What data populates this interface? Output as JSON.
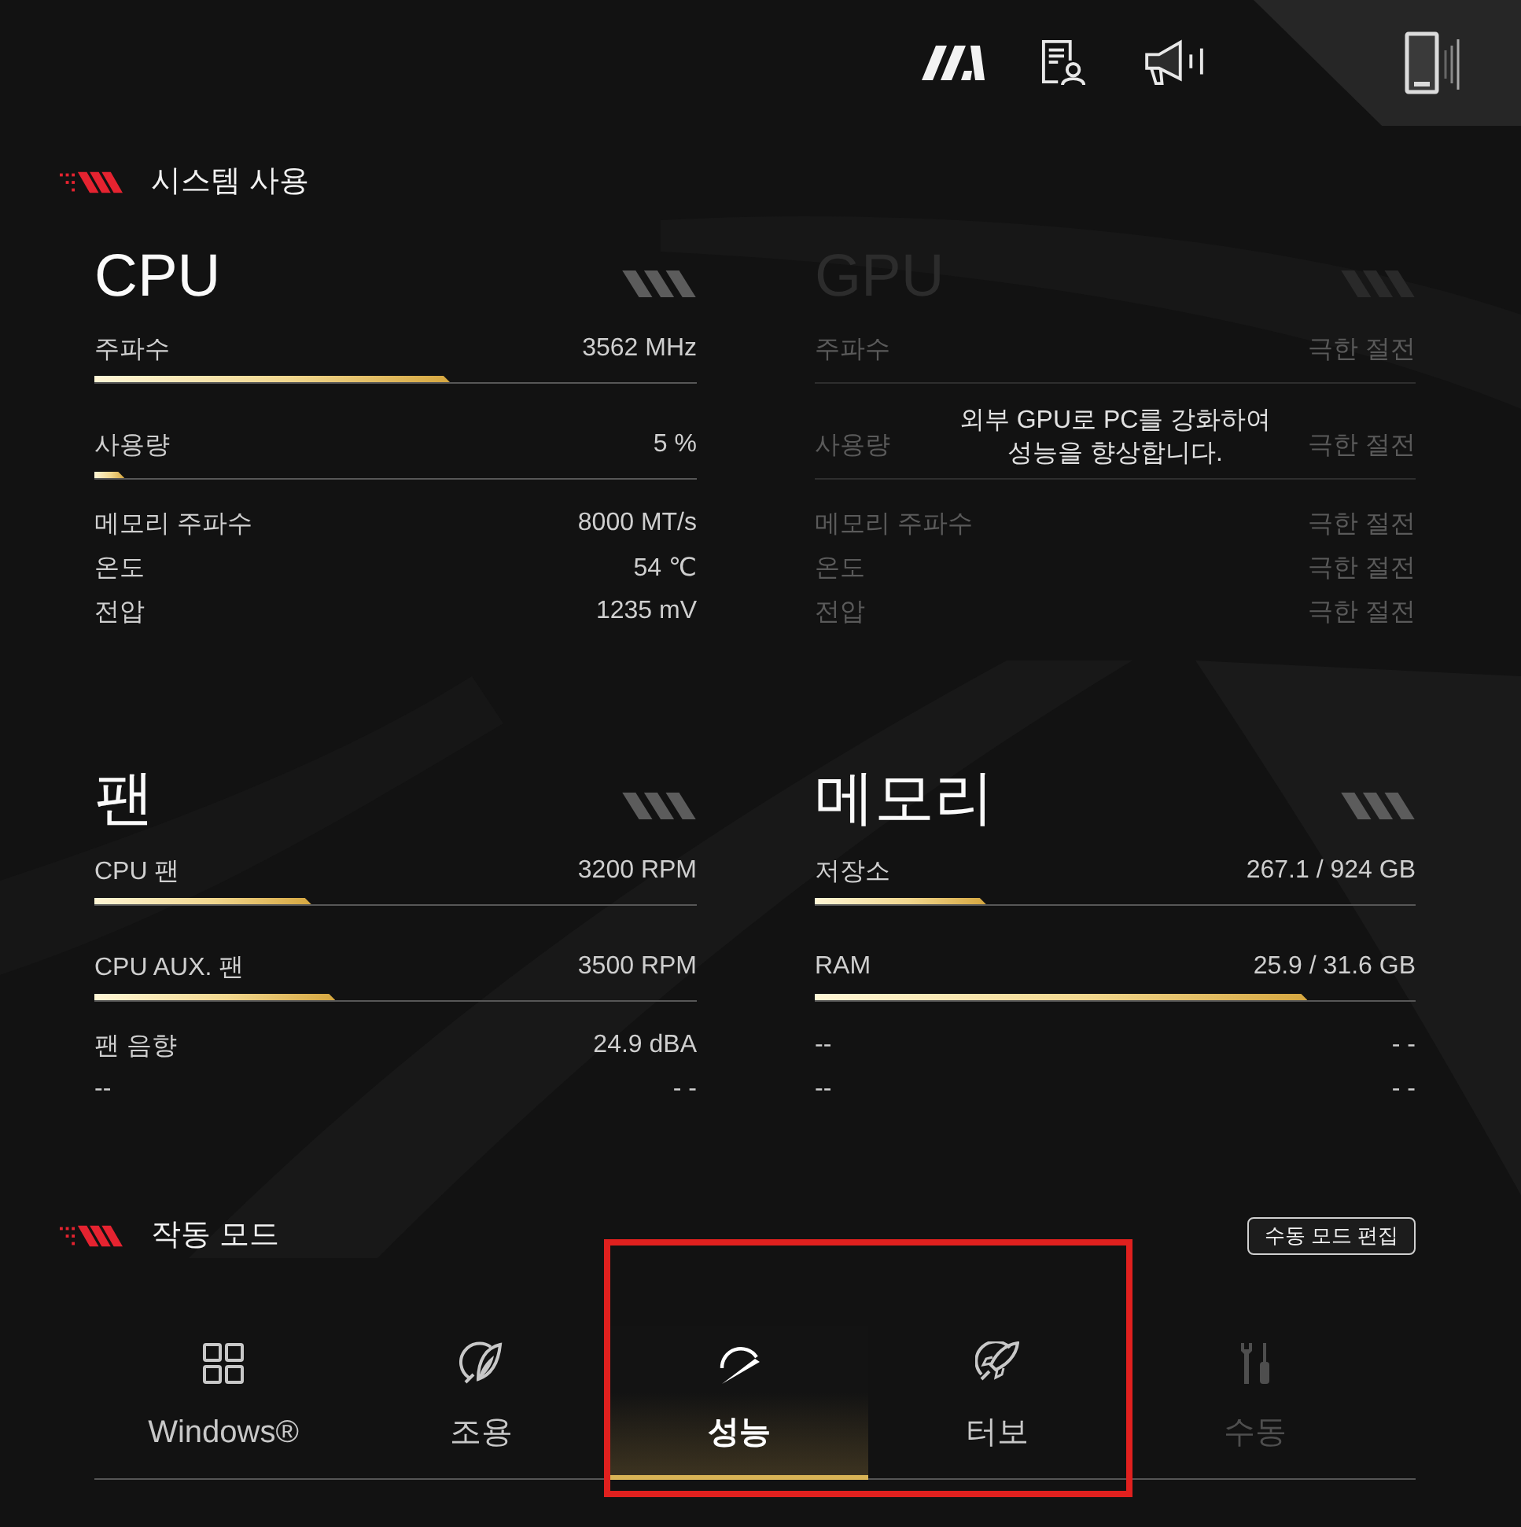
{
  "system_usage": {
    "title": "시스템 사용",
    "cards": [
      {
        "title": "CPU",
        "disabled": false,
        "rows": [
          {
            "kind": "bar",
            "label": "주파수",
            "value": "3562 MHz",
            "level": 0.59
          },
          {
            "kind": "bar",
            "label": "사용량",
            "value": "5 %",
            "level": 0.05
          },
          {
            "kind": "plain",
            "label": "메모리 주파수",
            "value": "8000 MT/s"
          },
          {
            "kind": "plain",
            "label": "온도",
            "value": "54 ℃"
          },
          {
            "kind": "plain",
            "label": "전압",
            "value": "1235 mV"
          }
        ]
      },
      {
        "title": "GPU",
        "disabled": true,
        "overlay_message": "외부 GPU로 PC를 강화하여 성능을 향상합니다.",
        "rows": [
          {
            "kind": "bar",
            "label": "주파수",
            "value": "극한 절전"
          },
          {
            "kind": "bar",
            "label": "사용량",
            "value": "극한 절전"
          },
          {
            "kind": "plain",
            "label": "메모리 주파수",
            "value": "극한 절전"
          },
          {
            "kind": "plain",
            "label": "온도",
            "value": "극한 절전"
          },
          {
            "kind": "plain",
            "label": "전압",
            "value": "극한 절전"
          }
        ]
      },
      {
        "title": "팬",
        "disabled": false,
        "rows": [
          {
            "kind": "bar",
            "label": "CPU 팬",
            "value": "3200 RPM",
            "level": 0.36
          },
          {
            "kind": "bar",
            "label": "CPU AUX. 팬",
            "value": "3500 RPM",
            "level": 0.4
          },
          {
            "kind": "plain",
            "label": "팬 음향",
            "value": "24.9 dBA"
          },
          {
            "kind": "plain",
            "label": "--",
            "value": "- -"
          }
        ]
      },
      {
        "title": "메모리",
        "disabled": false,
        "rows": [
          {
            "kind": "bar",
            "label": "저장소",
            "value": "267.1 / 924 GB",
            "level": 0.285
          },
          {
            "kind": "bar",
            "label": "RAM",
            "value": "25.9 / 31.6 GB",
            "level": 0.82
          },
          {
            "kind": "plain",
            "label": "--",
            "value": "- -"
          },
          {
            "kind": "plain",
            "label": "--",
            "value": "- -"
          }
        ]
      }
    ]
  },
  "operating_mode": {
    "title": "작동 모드",
    "edit_button": "수동 모드 편집",
    "modes": [
      {
        "kind": "windows",
        "label": "Windows®",
        "selected": false,
        "disabled": false,
        "highlighted": false
      },
      {
        "kind": "silent",
        "label": "조용",
        "selected": false,
        "disabled": false,
        "highlighted": false
      },
      {
        "kind": "performance",
        "label": "성능",
        "selected": true,
        "disabled": false,
        "highlighted": true
      },
      {
        "kind": "turbo",
        "label": "터보",
        "selected": false,
        "disabled": false,
        "highlighted": true
      },
      {
        "kind": "manual",
        "label": "수동",
        "selected": false,
        "disabled": true,
        "highlighted": false
      }
    ]
  }
}
